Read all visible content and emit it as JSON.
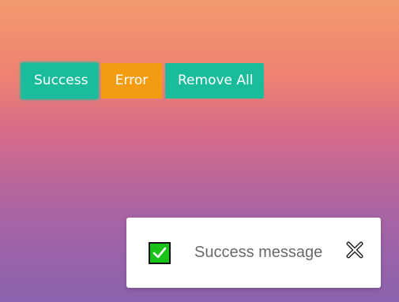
{
  "buttons": {
    "success_label": "Success",
    "error_label": "Error",
    "remove_all_label": "Remove All"
  },
  "toast": {
    "message": "Success message",
    "status_icon": "check-box-icon",
    "close_icon": "close-icon"
  },
  "colors": {
    "success": "#1abc9c",
    "error": "#f39c12",
    "check_green": "#18c218"
  }
}
